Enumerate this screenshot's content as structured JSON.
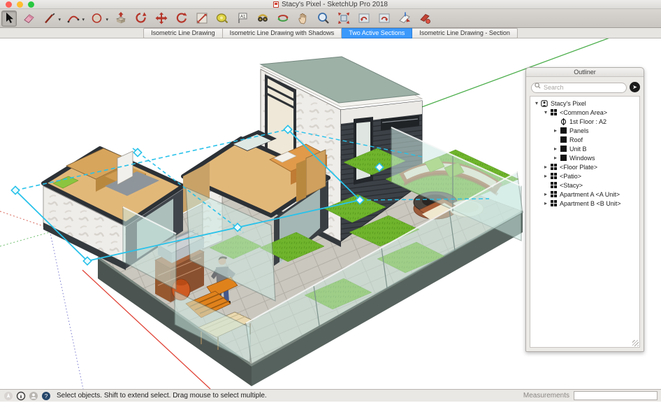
{
  "window": {
    "title": "Stacy's Pixel - SketchUp Pro 2018"
  },
  "toolbar": {
    "tools": [
      {
        "id": "select",
        "active": true
      },
      {
        "id": "eraser"
      },
      {
        "id": "line",
        "dropdown": true
      },
      {
        "id": "arc",
        "dropdown": true
      },
      {
        "id": "shapes",
        "dropdown": true
      },
      {
        "id": "push-pull"
      },
      {
        "id": "follow-me"
      },
      {
        "id": "move"
      },
      {
        "id": "rotate"
      },
      {
        "id": "scale"
      },
      {
        "id": "tape-measure"
      },
      {
        "id": "text"
      },
      {
        "id": "walk"
      },
      {
        "id": "orbit"
      },
      {
        "id": "pan"
      },
      {
        "id": "zoom"
      },
      {
        "id": "zoom-extents"
      },
      {
        "id": "previous-view"
      },
      {
        "id": "next-view"
      },
      {
        "id": "section-plane"
      },
      {
        "id": "section-display"
      }
    ]
  },
  "scene_tabs": [
    {
      "label": "Isometric Line Drawing",
      "active": false
    },
    {
      "label": "Isometric Line Drawing with Shadows",
      "active": false
    },
    {
      "label": "Two Active Sections",
      "active": true
    },
    {
      "label": "Isometric Line Drawing - Section",
      "active": false
    }
  ],
  "outliner": {
    "title": "Outliner",
    "search_placeholder": "Search",
    "tree": [
      {
        "label": "Stacy's Pixel",
        "icon": "model",
        "depth": 0,
        "expanded": true
      },
      {
        "label": "<Common Area>",
        "icon": "component",
        "depth": 1,
        "expanded": true
      },
      {
        "label": "1st Floor : A2",
        "icon": "section-plane",
        "depth": 2,
        "expanded": null
      },
      {
        "label": "Panels",
        "icon": "group",
        "depth": 2,
        "expanded": false
      },
      {
        "label": "Roof",
        "icon": "group",
        "depth": 2,
        "expanded": null
      },
      {
        "label": "Unit B",
        "icon": "group",
        "depth": 2,
        "expanded": false
      },
      {
        "label": "Windows",
        "icon": "group",
        "depth": 2,
        "expanded": false
      },
      {
        "label": "<Floor Plate>",
        "icon": "component",
        "depth": 1,
        "expanded": false
      },
      {
        "label": "<Patio>",
        "icon": "component",
        "depth": 1,
        "expanded": false
      },
      {
        "label": "<Stacy>",
        "icon": "component",
        "depth": 1,
        "expanded": null
      },
      {
        "label": "Apartment A <A Unit>",
        "icon": "component",
        "depth": 1,
        "expanded": false
      },
      {
        "label": "Apartment B <B Unit>",
        "icon": "component",
        "depth": 1,
        "expanded": false
      }
    ]
  },
  "status_bar": {
    "message": "Select objects. Shift to extend select. Drag mouse to select multiple.",
    "measurements_label": "Measurements",
    "measurements_value": ""
  },
  "colors": {
    "accent_blue": "#3b99fc",
    "section_cyan": "#29c2ea",
    "axis_red": "#e04438",
    "axis_green": "#4cae4c",
    "axis_blue": "#7a7ad0",
    "roof_sage": "#9db1a7",
    "grass_green": "#6fb42c",
    "siding_charcoal": "#3c4147",
    "wood_tan": "#d7a55c"
  }
}
